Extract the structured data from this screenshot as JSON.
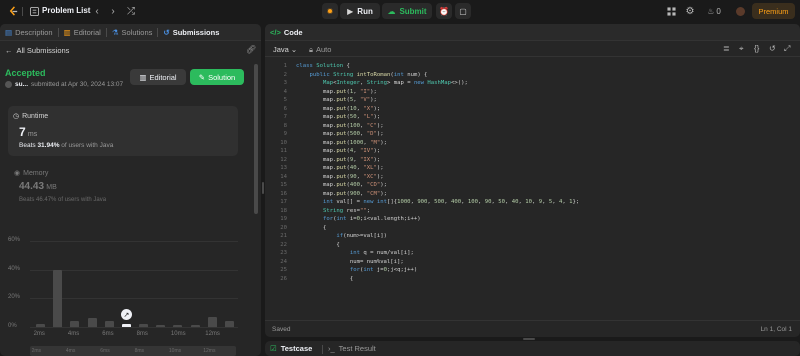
{
  "topbar": {
    "problem_list": "Problem List",
    "run": "Run",
    "submit": "Submit",
    "streak": "0",
    "premium": "Premium"
  },
  "left_tabs": [
    "Description",
    "Editorial",
    "Solutions",
    "Submissions"
  ],
  "submission": {
    "back_label": "All Submissions",
    "status": "Accepted",
    "user": "su...",
    "submitted_at": "submitted at Apr 30, 2024 13:07",
    "editorial_btn": "Editorial",
    "solution_btn": "Solution",
    "runtime_label": "Runtime",
    "runtime_value": "7",
    "runtime_unit": "ms",
    "runtime_beats_prefix": "Beats",
    "runtime_beats_pct": "31.94%",
    "runtime_beats_suffix": "of users with Java",
    "memory_label": "Memory",
    "memory_value": "44.43",
    "memory_unit": "MB",
    "memory_beats": "Beats 46.47% of users with Java"
  },
  "chart_data": {
    "type": "bar",
    "y_ticks": [
      "60%",
      "40%",
      "20%",
      "0%"
    ],
    "ylim": [
      0,
      60
    ],
    "x_ticks": [
      "2ms",
      "4ms",
      "6ms",
      "8ms",
      "10ms",
      "12ms"
    ],
    "values": [
      2,
      40,
      4,
      6,
      4,
      2,
      2,
      1,
      1,
      1,
      7,
      4
    ],
    "highlight_index": 5
  },
  "code_panel": {
    "title": "Code",
    "language": "Java",
    "mode": "Auto",
    "status_left": "Saved",
    "status_right": "Ln 1, Col 1"
  },
  "bottom_tabs": {
    "testcase": "Testcase",
    "test_result": "Test Result"
  },
  "code_lines": [
    "class Solution {",
    "    public String intToRoman(int num) {",
    "        Map<Integer, String> map = new HashMap<>();",
    "        map.put(1, \"I\");",
    "        map.put(5, \"V\");",
    "        map.put(10, \"X\");",
    "        map.put(50, \"L\");",
    "        map.put(100, \"C\");",
    "        map.put(500, \"D\");",
    "        map.put(1000, \"M\");",
    "        map.put(4, \"IV\");",
    "        map.put(9, \"IX\");",
    "        map.put(40, \"XL\");",
    "        map.put(90, \"XC\");",
    "        map.put(400, \"CD\");",
    "        map.put(900, \"CM\");",
    "        int val[] = new int[]{1000, 900, 500, 400, 100, 90, 50, 40, 10, 9, 5, 4, 1};",
    "        String res=\"\";",
    "        for(int i=0;i<val.length;i++)",
    "        {",
    "            if(num>=val[i])",
    "            {",
    "                int q = num/val[i];",
    "                num= num%val[i];",
    "                for(int j=0;j<q;j++)",
    "                {"
  ]
}
